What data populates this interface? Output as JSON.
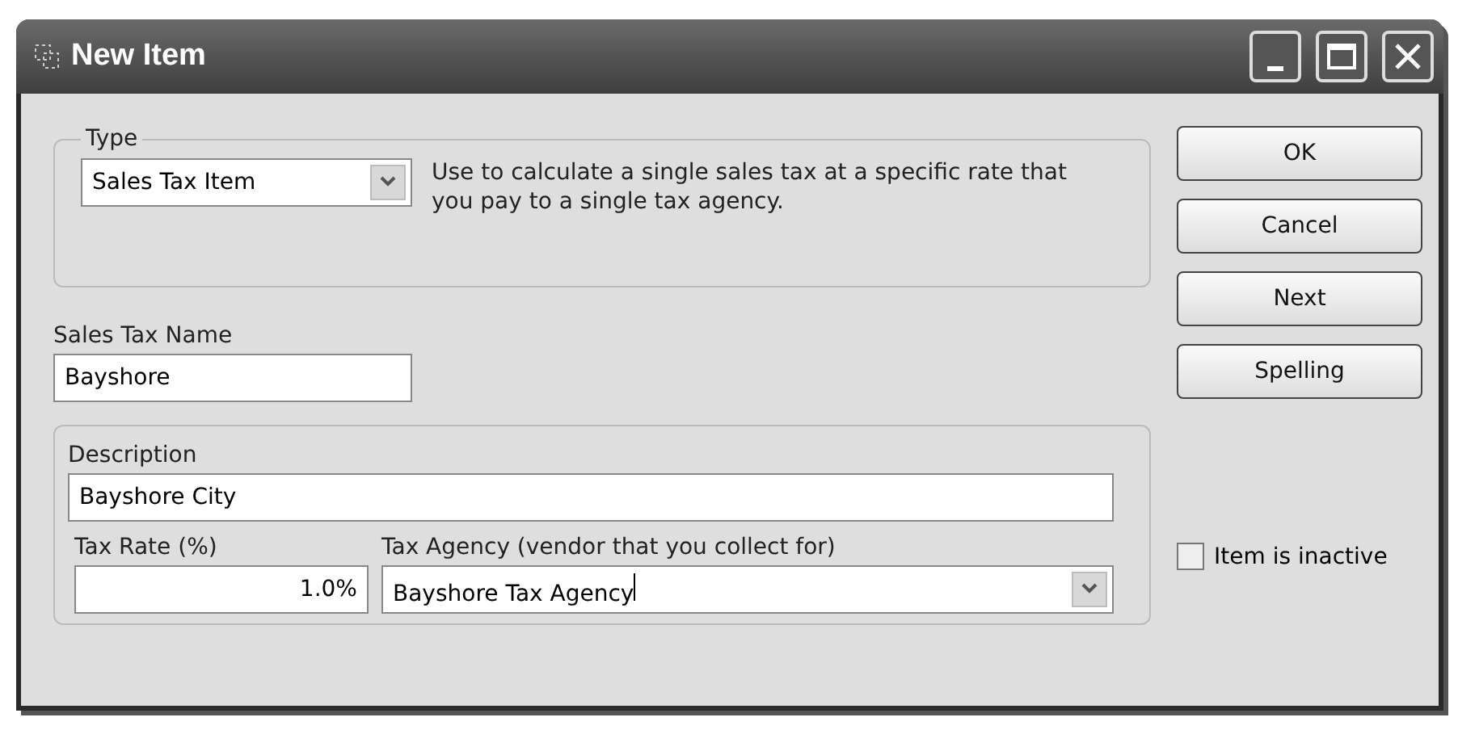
{
  "window": {
    "title": "New Item"
  },
  "type": {
    "legend": "Type",
    "value": "Sales Tax Item",
    "description": "Use to calculate a single sales tax at a specific rate that you pay to a single tax agency."
  },
  "sales_tax_name": {
    "label": "Sales Tax Name",
    "value": "Bayshore"
  },
  "description": {
    "label": "Description",
    "value": "Bayshore City"
  },
  "tax_rate": {
    "label": "Tax Rate (%)",
    "value": "1.0%"
  },
  "tax_agency": {
    "label": "Tax Agency (vendor that you collect for)",
    "value": "Bayshore Tax Agency"
  },
  "buttons": [
    "OK",
    "Cancel",
    "Next",
    "Spelling"
  ],
  "inactive": {
    "label": "Item is inactive",
    "checked": false
  }
}
